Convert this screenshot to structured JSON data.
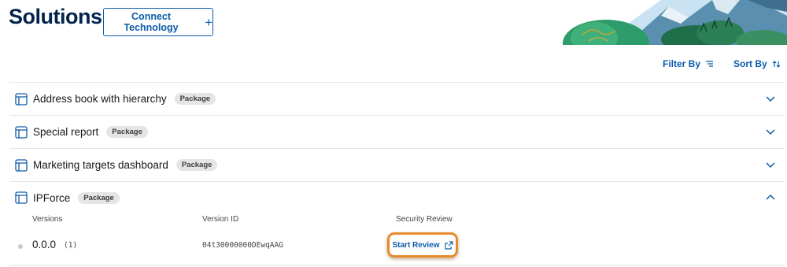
{
  "header": {
    "title": "Solutions",
    "connect_label": "Connect Technology",
    "connect_icon": "plus-icon"
  },
  "toolbar": {
    "filter_label": "Filter By",
    "filter_icon": "filter-icon",
    "sort_label": "Sort By",
    "sort_icon": "sort-icon"
  },
  "solutions": [
    {
      "title": "Address book with hierarchy",
      "badge": "Package",
      "expanded": false
    },
    {
      "title": "Special report",
      "badge": "Package",
      "expanded": false
    },
    {
      "title": "Marketing targets dashboard",
      "badge": "Package",
      "expanded": false
    },
    {
      "title": "IPForce",
      "badge": "Package",
      "expanded": true
    }
  ],
  "versions": {
    "headers": {
      "versions": "Versions",
      "version_id": "Version ID",
      "security_review": "Security Review"
    },
    "rows": [
      {
        "version": "0.0.0",
        "count": "(1)",
        "version_id": "04t30000000DEwqAAG",
        "review_label": "Start Review"
      }
    ]
  },
  "colors": {
    "brand_blue": "#0b5cab",
    "title_navy": "#03234d",
    "highlight_orange": "#e68a2e"
  }
}
